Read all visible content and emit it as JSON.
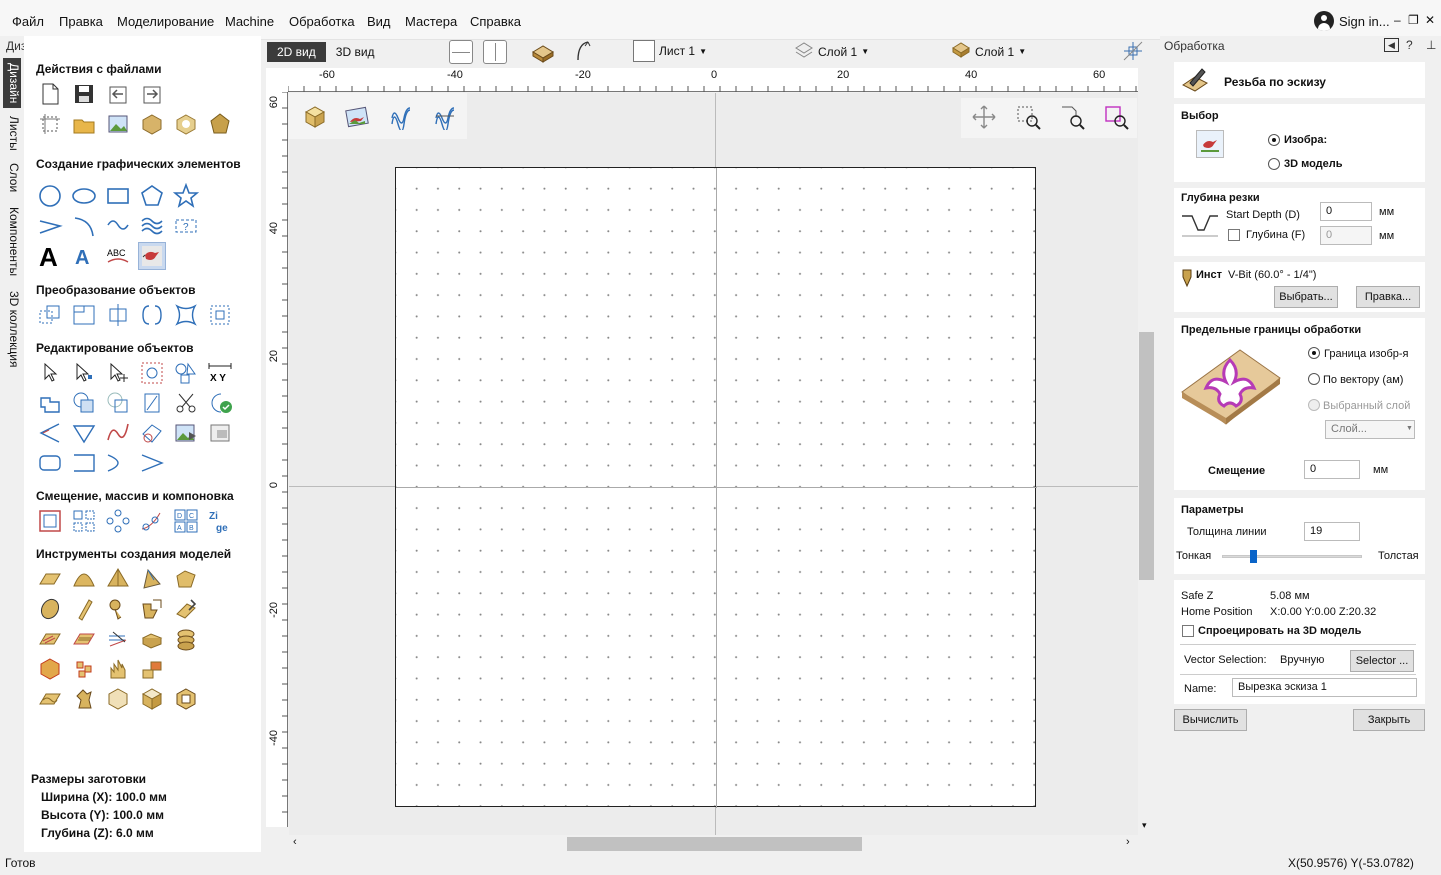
{
  "menu": [
    "Файл",
    "Правка",
    "Моделирование",
    "Machine",
    "Обработка",
    "Вид",
    "Мастера",
    "Справка"
  ],
  "signin": "Sign in...",
  "left": {
    "header": "Дизайн",
    "tabs": [
      "Дизайн",
      "Листы",
      "Слои",
      "Компоненты",
      "3D коллекция"
    ],
    "sections": {
      "file_actions": "Действия с файлами",
      "create_graphics": "Создание графических элементов",
      "transform": "Преобразование объектов",
      "edit": "Редактирование объектов",
      "offset": "Смещение, массив и компоновка",
      "modeling": "Инструменты создания моделей"
    },
    "text_tool_sample": "ABC",
    "xy_label": "X Y",
    "dims": {
      "title": "Размеры заготовки",
      "width": "Ширина  (X): 100.0 мм",
      "height": "Высота  (Y): 100.0 мм",
      "depth": "Глубина (Z): 6.0 мм"
    }
  },
  "toolbar": {
    "tab2d": "2D вид",
    "tab3d": "3D вид",
    "sheet": "Лист 1",
    "layer_a": "Слой 1",
    "layer_b": "Слой 1"
  },
  "ruler": {
    "top": [
      "-60",
      "-40",
      "-20",
      "0",
      "20",
      "40",
      "60"
    ],
    "left": [
      "60",
      "40",
      "20",
      "0",
      "-20",
      "-40"
    ]
  },
  "right": {
    "header": "Обработка",
    "title": "Резьба по эскизу",
    "selection": {
      "title": "Выбор",
      "opt_image": "Изобра:",
      "opt_3d": "3D модель"
    },
    "depth": {
      "title": "Глубина резки",
      "start_label": "Start Depth (D)",
      "start_value": "0",
      "depth_label": "Глубина (F)",
      "depth_value": "0",
      "unit": "мм"
    },
    "tool": {
      "label": "Инст",
      "name": "V-Bit (60.0° - 1/4\")",
      "select_btn": "Выбрать...",
      "edit_btn": "Правка..."
    },
    "bounds": {
      "title": "Предельные границы обработки",
      "opt_image": "Граница изобр-я",
      "opt_vector": "По вектору (ам)",
      "opt_layer": "Выбранный слой",
      "layer_placeholder": "Слой...",
      "offset_label": "Смещение",
      "offset_value": "0",
      "unit": "мм"
    },
    "params": {
      "title": "Параметры",
      "line_thickness_label": "Толщина линии",
      "line_thickness_value": "19",
      "thin": "Тонкая",
      "thick": "Толстая",
      "slider_value": 0.2
    },
    "info": {
      "safe_z_label": "Safe Z",
      "safe_z_value": "5.08 мм",
      "home_label": "Home Position",
      "home_value": "X:0.00 Y:0.00 Z:20.32",
      "project_label": "Спроецировать на 3D модель",
      "vector_sel_label": "Vector Selection:",
      "vector_sel_value": "Вручную",
      "selector_btn": "Selector ...",
      "name_label": "Name:",
      "name_value": "Вырезка эскиза 1"
    },
    "calc_btn": "Вычислить",
    "close_btn": "Закрыть"
  },
  "status": {
    "left": "Готов",
    "coords": "X(50.9576) Y(-53.0782)"
  }
}
